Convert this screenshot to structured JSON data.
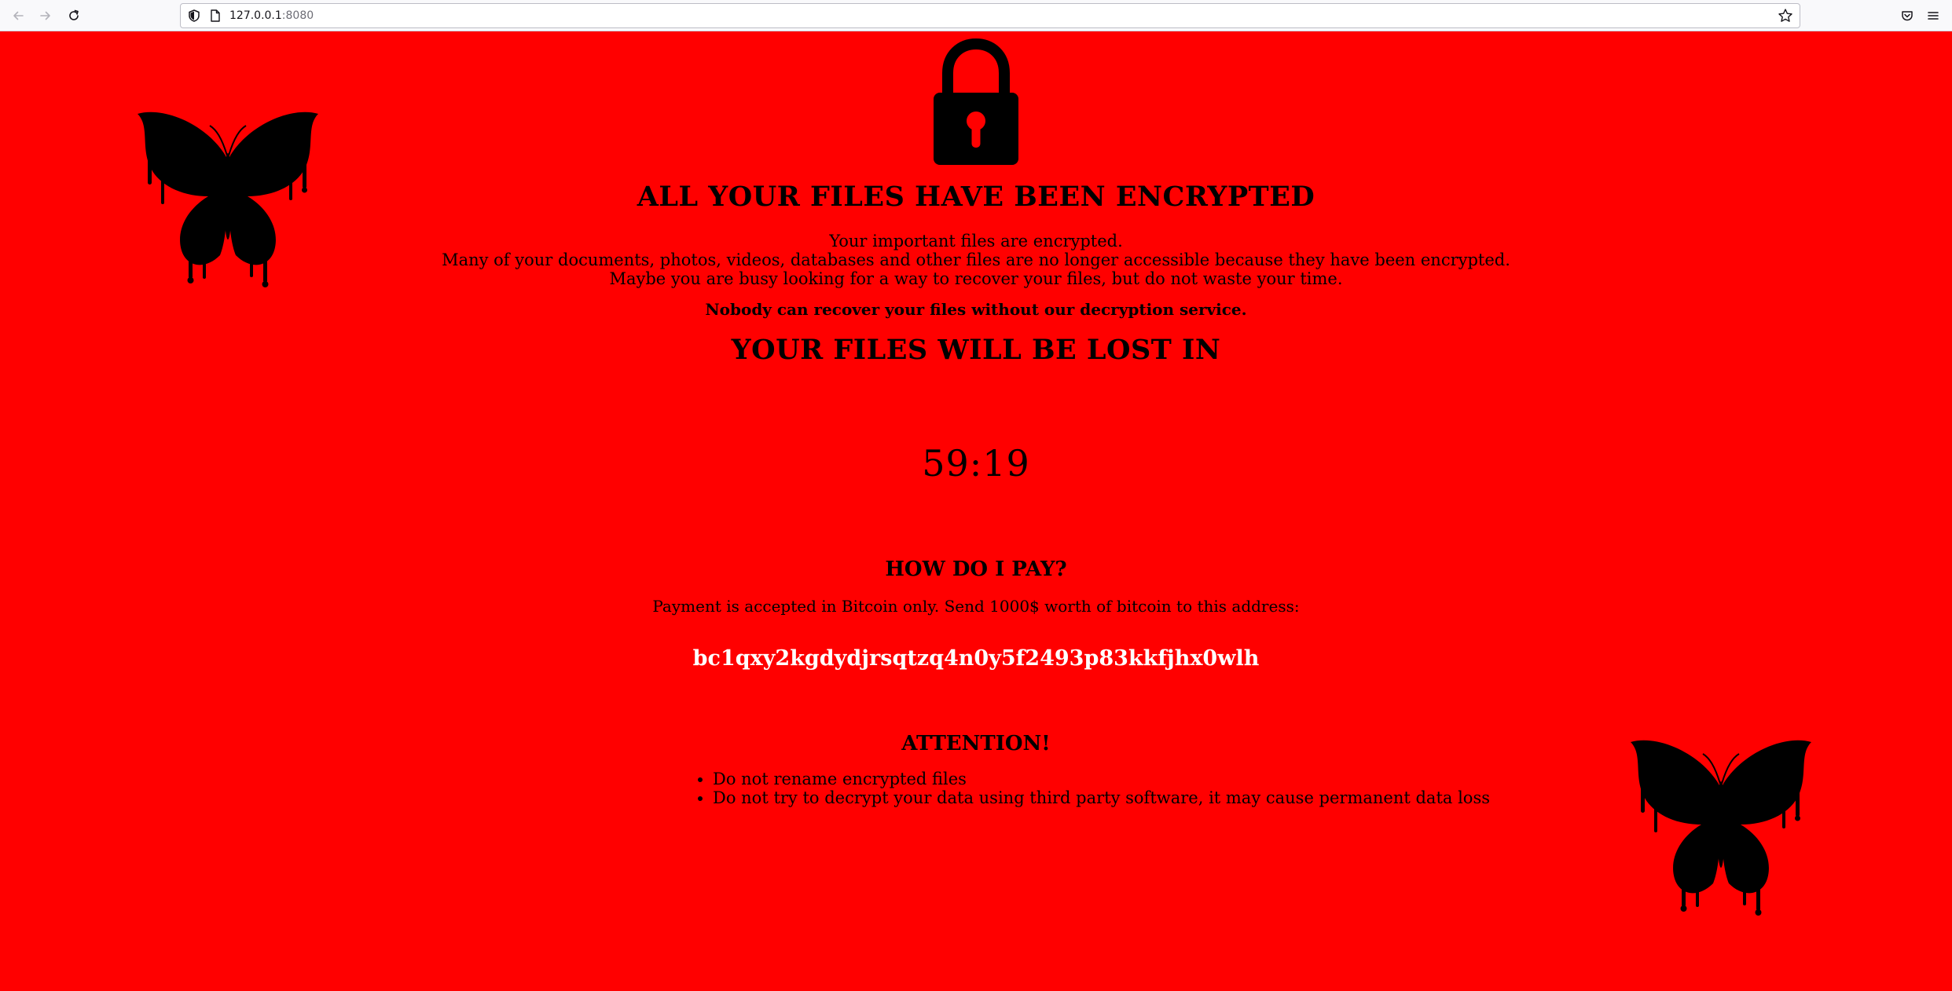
{
  "browser": {
    "url_host": "127.0.0.1",
    "url_port": ":8080",
    "icons": {
      "back": "back-arrow-icon",
      "forward": "forward-arrow-icon",
      "reload": "reload-icon",
      "site_info": "shield-icon",
      "page": "page-icon",
      "bookmark": "star-icon",
      "pocket": "pocket-icon",
      "menu": "hamburger-menu-icon"
    }
  },
  "page": {
    "background_color": "#ff0000",
    "title": "ALL YOUR FILES HAVE BEEN ENCRYPTED",
    "intro_lines": [
      "Your important files are encrypted.",
      "Many of your documents, photos, videos, databases and other files are no longer accessible because they have been encrypted.",
      "Maybe you are busy looking for a way to recover your files, but do not waste your time."
    ],
    "nobody_text": "Nobody can recover your files without our decryption service.",
    "lost_heading": "YOUR FILES WILL BE LOST IN",
    "timer": "59:19",
    "pay_heading": "HOW DO I PAY?",
    "pay_text": "Payment is accepted in Bitcoin only. Send 1000$ worth of bitcoin to this address:",
    "btc_address": "bc1qxy2kgdydjrsqtzq4n0y5f2493p83kkfjhx0wlh",
    "attention_heading": "ATTENTION!",
    "warnings": [
      "Do not rename encrypted files",
      "Do not try to decrypt your data using third party software, it may cause permanent data loss"
    ],
    "decor_icons": [
      "padlock-icon",
      "butterfly-icon"
    ]
  }
}
